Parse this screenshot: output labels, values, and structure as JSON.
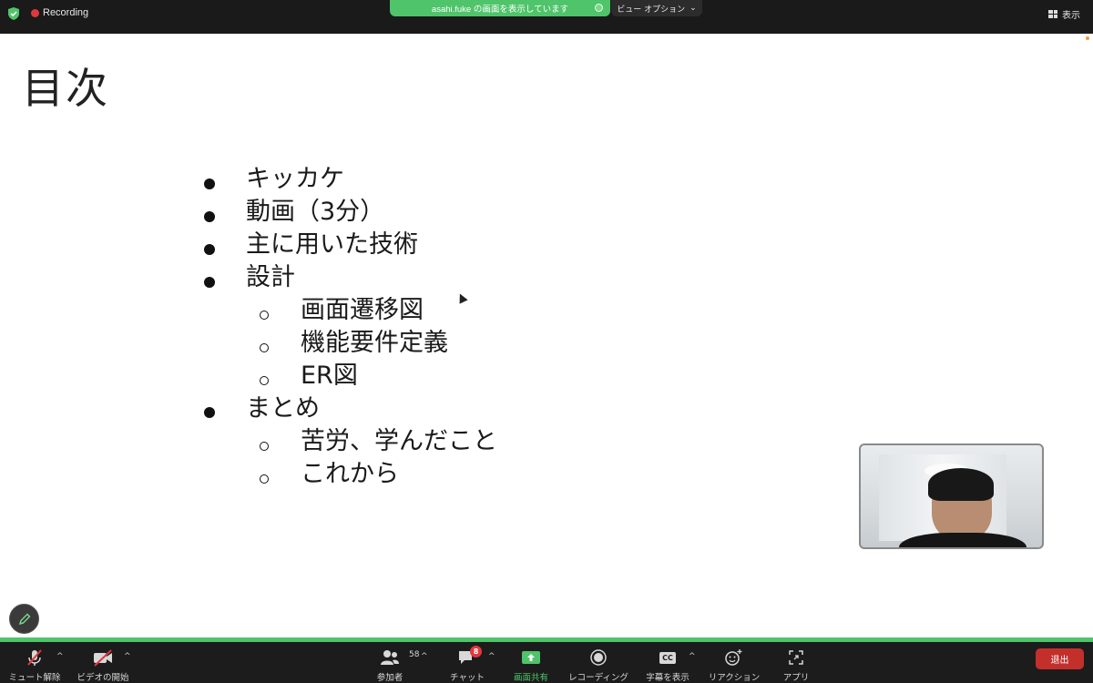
{
  "topbar": {
    "recording_label": "Recording",
    "share_banner": "asahi.fuke の画面を表示しています",
    "view_options": "ビュー オプション",
    "view_label": "表示"
  },
  "slide": {
    "title": "目次",
    "bullets": [
      {
        "level": 1,
        "text": "キッカケ"
      },
      {
        "level": 1,
        "text": "動画（3分）"
      },
      {
        "level": 1,
        "text": "主に用いた技術"
      },
      {
        "level": 1,
        "text": "設計"
      },
      {
        "level": 2,
        "text": "画面遷移図"
      },
      {
        "level": 2,
        "text": "機能要件定義"
      },
      {
        "level": 2,
        "text": "ER図"
      },
      {
        "level": 1,
        "text": "まとめ"
      },
      {
        "level": 2,
        "text": "苦労、学んだこと"
      },
      {
        "level": 2,
        "text": "これから"
      }
    ]
  },
  "toolbar": {
    "mute": "ミュート解除",
    "video": "ビデオの開始",
    "participants": "参加者",
    "participants_count": "58",
    "chat": "チャット",
    "chat_badge": "8",
    "share": "画面共有",
    "recording": "レコーディング",
    "captions": "字幕を表示",
    "cc": "CC",
    "reactions": "リアクション",
    "apps": "アプリ",
    "leave": "退出"
  },
  "colors": {
    "accent_green": "#4fc46a",
    "leave_red": "#c3302c",
    "recording_red": "#e0383e"
  }
}
